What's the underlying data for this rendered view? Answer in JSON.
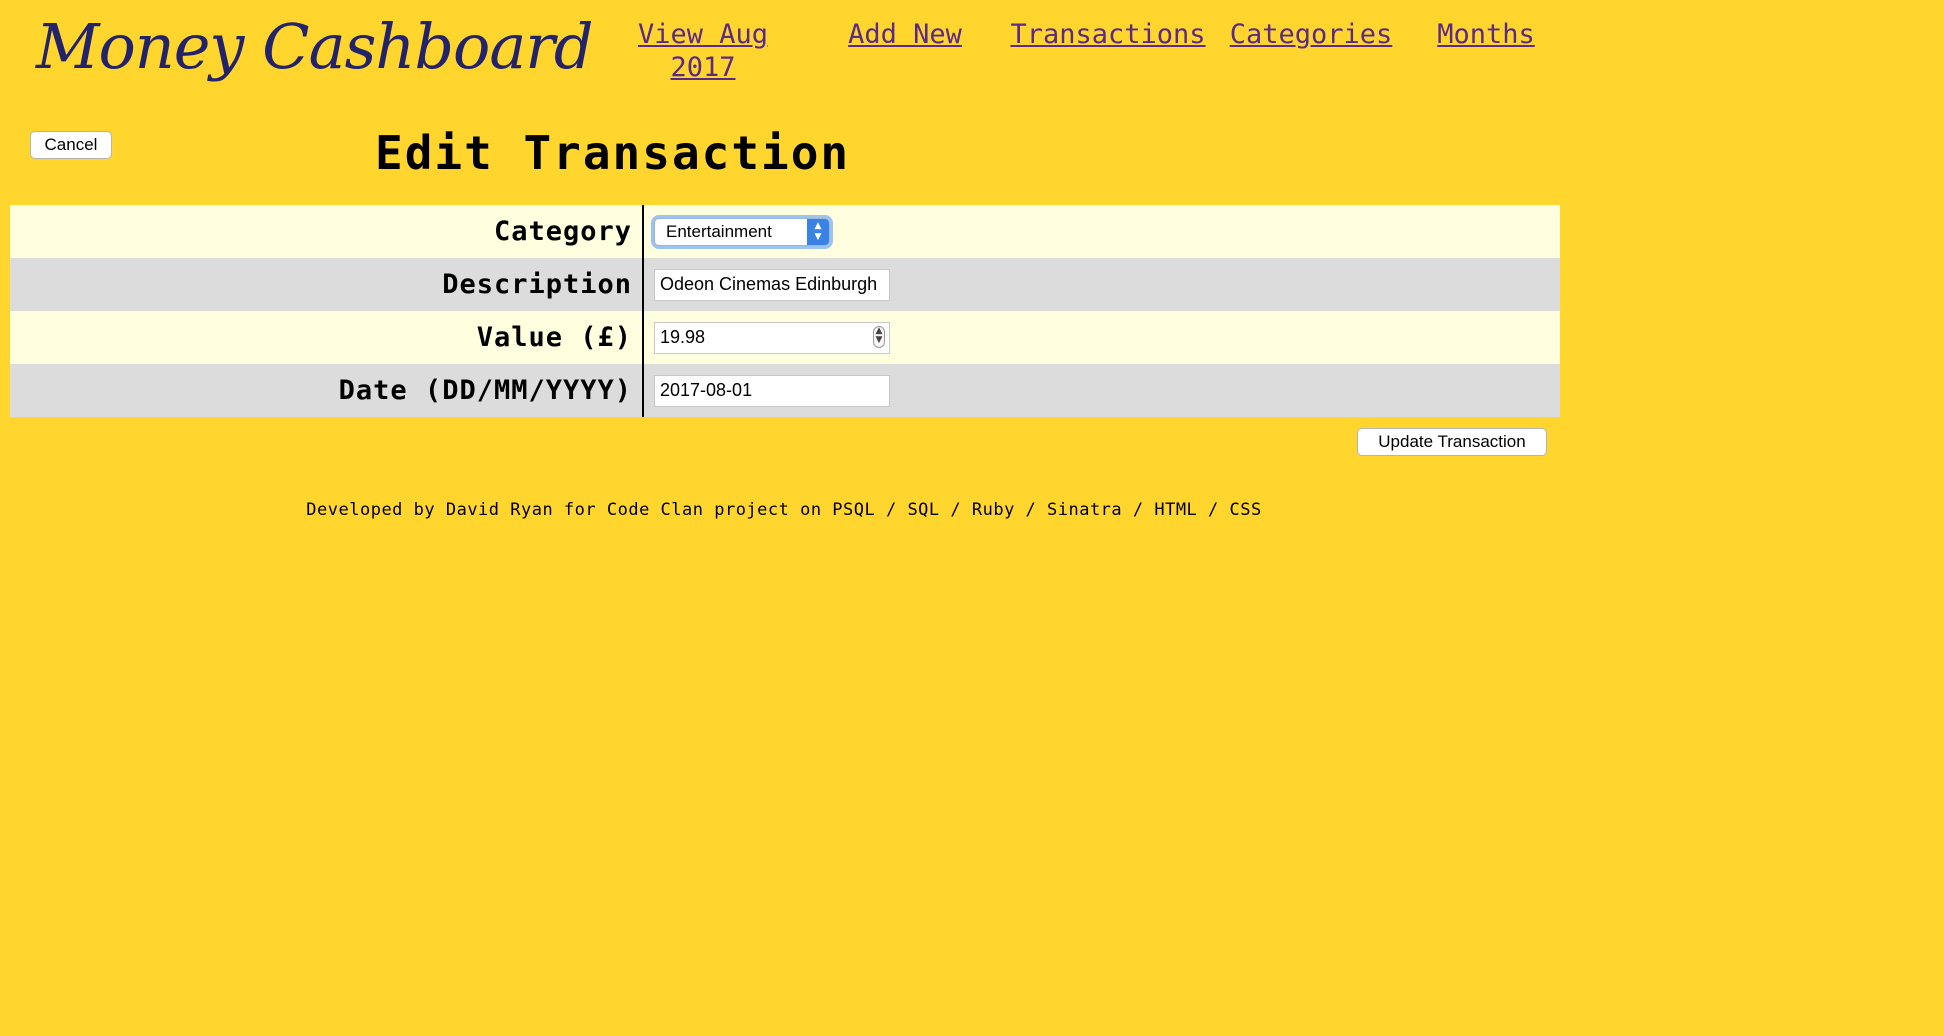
{
  "header": {
    "logo": "Money Cashboard",
    "nav": {
      "view_month": "View Aug 2017",
      "add_new": "Add New",
      "transactions": "Transactions",
      "categories": "Categories",
      "months": "Months"
    }
  },
  "page": {
    "cancel_label": "Cancel",
    "title": "Edit Transaction",
    "update_label": "Update Transaction"
  },
  "form": {
    "category": {
      "label": "Category",
      "value": "Entertainment"
    },
    "description": {
      "label": "Description",
      "value": "Odeon Cinemas Edinburgh"
    },
    "amount": {
      "label": "Value (£)",
      "value": "19.98"
    },
    "date": {
      "label": "Date (DD/MM/YYYY)",
      "value": "2017-08-01"
    }
  },
  "footer": {
    "credit": "Developed by David Ryan for Code Clan project on PSQL / SQL / Ruby / Sinatra / HTML / CSS"
  },
  "colors": {
    "background": "#ffd52e",
    "logo": "#23236b",
    "nav_link": "#5b2a86",
    "row_light": "#ffffdf",
    "row_dark": "#dcdcdc",
    "select_accent": "#3b82e6"
  },
  "icons": {
    "select": "chevron-up-down-icon",
    "number": "spinner-icon"
  }
}
